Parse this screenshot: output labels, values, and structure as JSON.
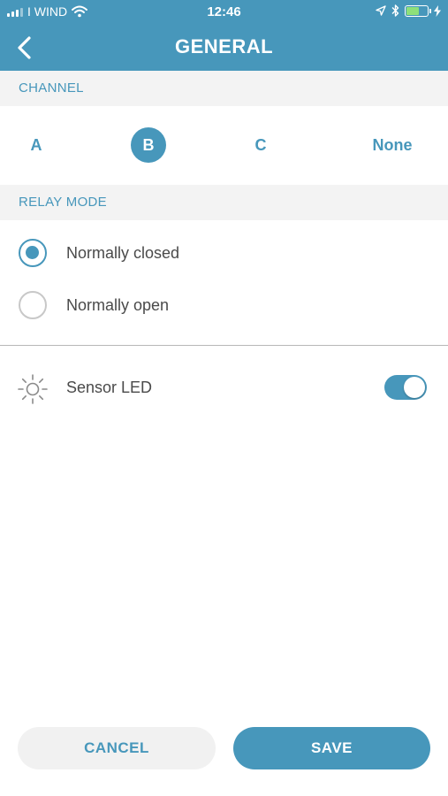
{
  "status_bar": {
    "carrier": "I WIND",
    "time": "12:46"
  },
  "header": {
    "title": "GENERAL"
  },
  "channel": {
    "section_label": "CHANNEL",
    "options": [
      "A",
      "B",
      "C",
      "None"
    ],
    "selected": "B"
  },
  "relay_mode": {
    "section_label": "RELAY MODE",
    "options": [
      {
        "label": "Normally closed",
        "selected": true
      },
      {
        "label": "Normally open",
        "selected": false
      }
    ]
  },
  "sensor_led": {
    "label": "Sensor LED",
    "enabled": true
  },
  "actions": {
    "cancel_label": "CANCEL",
    "save_label": "SAVE"
  },
  "colors": {
    "accent": "#4797bb",
    "section_bg": "#f3f3f3",
    "text": "#4a4a4a"
  }
}
